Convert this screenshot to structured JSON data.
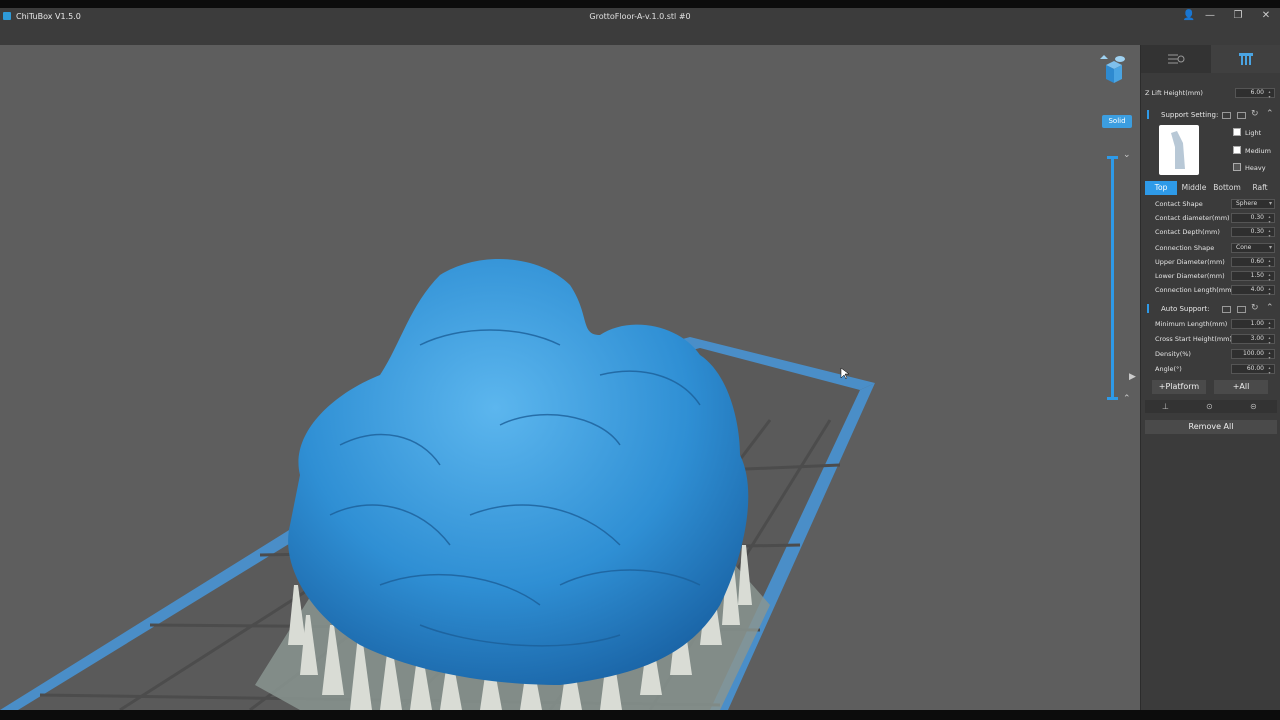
{
  "app": {
    "title": "ChiTuBox V1.5.0",
    "document_title": "GrottoFloor-A-v.1.0.stl #0"
  },
  "window_controls": {
    "user": "👤",
    "minimize": "—",
    "restore": "❐",
    "close": "✕"
  },
  "viewport": {
    "solid_label": "Solid",
    "slider_up": "⌃",
    "slider_down": "⌄",
    "expand_arrow": "▶"
  },
  "panel": {
    "z_lift": {
      "label": "Z Lift Height(mm)",
      "value": "6.00"
    },
    "support_setting": {
      "title": "Support Setting:",
      "presets": [
        {
          "label": "Light",
          "checked": false
        },
        {
          "label": "Medium",
          "checked": false
        },
        {
          "label": "Heavy",
          "checked": true
        }
      ]
    },
    "subtabs": [
      "Top",
      "Middle",
      "Bottom",
      "Raft"
    ],
    "top_params": [
      {
        "label": "Contact Shape",
        "value": "Sphere",
        "kind": "select"
      },
      {
        "label": "Contact diameter(mm)",
        "value": "0.30",
        "kind": "number"
      },
      {
        "label": "Contact Depth(mm)",
        "value": "0.30",
        "kind": "number"
      },
      {
        "label": "Connection Shape",
        "value": "Cone",
        "kind": "select"
      },
      {
        "label": "Upper Diameter(mm)",
        "value": "0.60",
        "kind": "number"
      },
      {
        "label": "Lower Diameter(mm)",
        "value": "1.50",
        "kind": "number"
      },
      {
        "label": "Connection Length(mm)",
        "value": "4.00",
        "kind": "number"
      }
    ],
    "auto_support": {
      "title": "Auto Support:",
      "params": [
        {
          "label": "Minimum Length(mm)",
          "value": "1.00"
        },
        {
          "label": "Cross Start Height(mm)",
          "value": "3.00"
        },
        {
          "label": "Density(%)",
          "value": "100.00"
        },
        {
          "label": "Angle(°)",
          "value": "60.00"
        }
      ]
    },
    "buttons": {
      "platform": "+Platform",
      "all": "+All",
      "remove_all": "Remove All"
    }
  },
  "colors": {
    "accent": "#2e9ae8",
    "model": "#3a96d8",
    "support": "#d9dcd5",
    "bed": "#4a8ec8"
  }
}
